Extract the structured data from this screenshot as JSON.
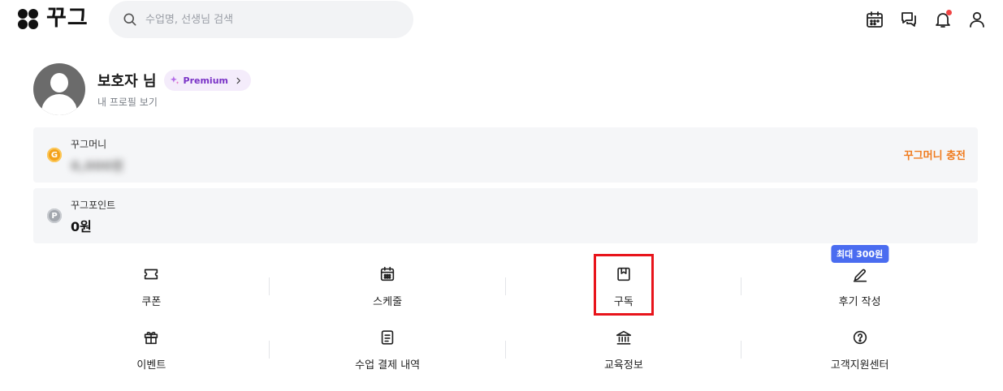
{
  "header": {
    "logo_text": "꾸그",
    "search_placeholder": "수업명, 선생님 검색",
    "icons": [
      "calendar-icon",
      "chat-icon",
      "bell-icon",
      "user-icon"
    ],
    "notification_dot": true
  },
  "profile": {
    "name": "보호자 님",
    "premium_label": "Premium",
    "link_label": "내 프로필 보기"
  },
  "money": {
    "coin_letter": "G",
    "label": "꾸그머니",
    "value": "0,000원",
    "charge_label": "꾸그머니 충전"
  },
  "point": {
    "coin_letter": "P",
    "label": "꾸그포인트",
    "value": "0원"
  },
  "menu": {
    "items": [
      {
        "label": "쿠폰",
        "icon": "ticket-icon"
      },
      {
        "label": "스케줄",
        "icon": "calendar-icon"
      },
      {
        "label": "구독",
        "icon": "bookmark-icon"
      },
      {
        "label": "후기 작성",
        "icon": "pen-icon",
        "badge": "최대 300원"
      },
      {
        "label": "이벤트",
        "icon": "gift-icon"
      },
      {
        "label": "수업 결제 내역",
        "icon": "receipt-icon"
      },
      {
        "label": "교육정보",
        "icon": "bank-icon"
      },
      {
        "label": "고객지원센터",
        "icon": "question-icon"
      }
    ]
  },
  "colors": {
    "accent_orange": "#f07b1e",
    "premium_purple": "#7a33c7",
    "badge_blue": "#4a6cf0",
    "highlight_red": "#e8141b"
  }
}
